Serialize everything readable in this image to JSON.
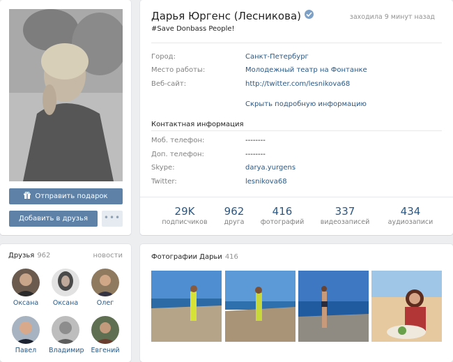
{
  "profile": {
    "name": "Дарья Юргенс (Лесникова)",
    "online": "заходила 9 минут назад",
    "status": "#Save Donbass People!",
    "send_gift": "Отправить подарок",
    "add_friend": "Добавить в друзья",
    "more": "•••"
  },
  "info": {
    "city_label": "Город:",
    "city": "Санкт-Петербург",
    "work_label": "Место работы:",
    "work": "Молодежный театр на Фонтанке",
    "site_label": "Веб-сайт:",
    "site": "http://twitter.com/lesnikova68",
    "hide_details": "Скрыть подробную информацию",
    "contacts_title": "Контактная информация",
    "mobile_label": "Моб. телефон:",
    "mobile": "--------",
    "extra_phone_label": "Доп. телефон:",
    "extra_phone": "--------",
    "skype_label": "Skype:",
    "skype": "darya.yurgens",
    "twitter_label": "Twitter:",
    "twitter": "lesnikova68"
  },
  "counters": [
    {
      "num": "29K",
      "label": "подписчиков"
    },
    {
      "num": "962",
      "label": "друга"
    },
    {
      "num": "416",
      "label": "фотографий"
    },
    {
      "num": "337",
      "label": "видеозаписей"
    },
    {
      "num": "434",
      "label": "аудиозаписи"
    }
  ],
  "friends": {
    "title": "Друзья",
    "count": "962",
    "news": "новости",
    "items": [
      {
        "name": "Оксана"
      },
      {
        "name": "Оксана"
      },
      {
        "name": "Олег"
      },
      {
        "name": "Павел"
      },
      {
        "name": "Владимир"
      },
      {
        "name": "Евгений"
      }
    ]
  },
  "photos": {
    "title": "Фотографии Дарьи",
    "count": "416"
  },
  "colors": {
    "accent": "#2a5885",
    "button": "#5e81a8",
    "background": "#edeef0"
  }
}
